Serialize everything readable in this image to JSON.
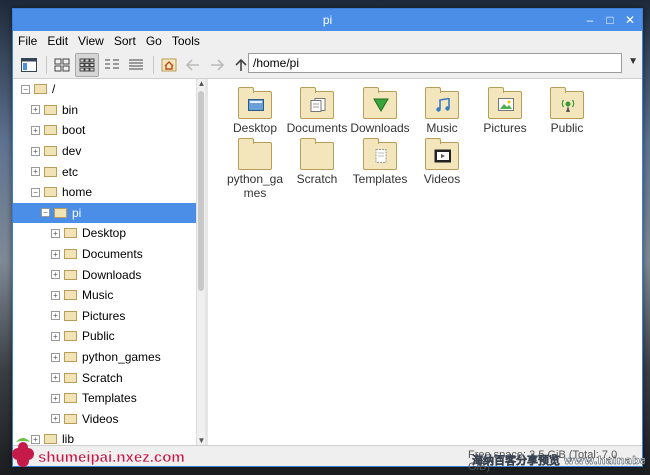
{
  "window": {
    "title": "pi"
  },
  "menu": [
    "File",
    "Edit",
    "View",
    "Sort",
    "Go",
    "Tools"
  ],
  "address": {
    "path": "/home/pi"
  },
  "tree": [
    {
      "label": "/",
      "depth": 0,
      "exp": "−"
    },
    {
      "label": "bin",
      "depth": 1,
      "exp": "+"
    },
    {
      "label": "boot",
      "depth": 1,
      "exp": "+"
    },
    {
      "label": "dev",
      "depth": 1,
      "exp": "+"
    },
    {
      "label": "etc",
      "depth": 1,
      "exp": "+"
    },
    {
      "label": "home",
      "depth": 1,
      "exp": "−"
    },
    {
      "label": "pi",
      "depth": 2,
      "exp": "−",
      "selected": true
    },
    {
      "label": "Desktop",
      "depth": 3,
      "exp": "+"
    },
    {
      "label": "Documents",
      "depth": 3,
      "exp": "+"
    },
    {
      "label": "Downloads",
      "depth": 3,
      "exp": "+"
    },
    {
      "label": "Music",
      "depth": 3,
      "exp": "+"
    },
    {
      "label": "Pictures",
      "depth": 3,
      "exp": "+"
    },
    {
      "label": "Public",
      "depth": 3,
      "exp": "+"
    },
    {
      "label": "python_games",
      "depth": 3,
      "exp": "+"
    },
    {
      "label": "Scratch",
      "depth": 3,
      "exp": "+"
    },
    {
      "label": "Templates",
      "depth": 3,
      "exp": "+"
    },
    {
      "label": "Videos",
      "depth": 3,
      "exp": "+"
    },
    {
      "label": "lib",
      "depth": 1,
      "exp": "+"
    }
  ],
  "files": [
    {
      "label": "Desktop",
      "icon": "desktop-icon"
    },
    {
      "label": "Documents",
      "icon": "documents-icon"
    },
    {
      "label": "Downloads",
      "icon": "download-arrow-icon"
    },
    {
      "label": "Music",
      "icon": "music-note-icon"
    },
    {
      "label": "Pictures",
      "icon": "picture-icon"
    },
    {
      "label": "Public",
      "icon": "share-icon"
    },
    {
      "label": "python_games",
      "icon": "folder-icon"
    },
    {
      "label": "Scratch",
      "icon": "folder-icon"
    },
    {
      "label": "Templates",
      "icon": "template-icon"
    },
    {
      "label": "Videos",
      "icon": "film-icon"
    }
  ],
  "status": {
    "text": "Free space: 3.5 GiB (Total: 7.0 GiB)"
  },
  "watermarks": {
    "left": "shumeipai.nxez.com",
    "right": "海纳百客分享预览 www.hainabaike.com"
  },
  "colors": {
    "accent": "#4b8ee8",
    "folder": "#f3e6bd",
    "folder_border": "#b89e58"
  }
}
